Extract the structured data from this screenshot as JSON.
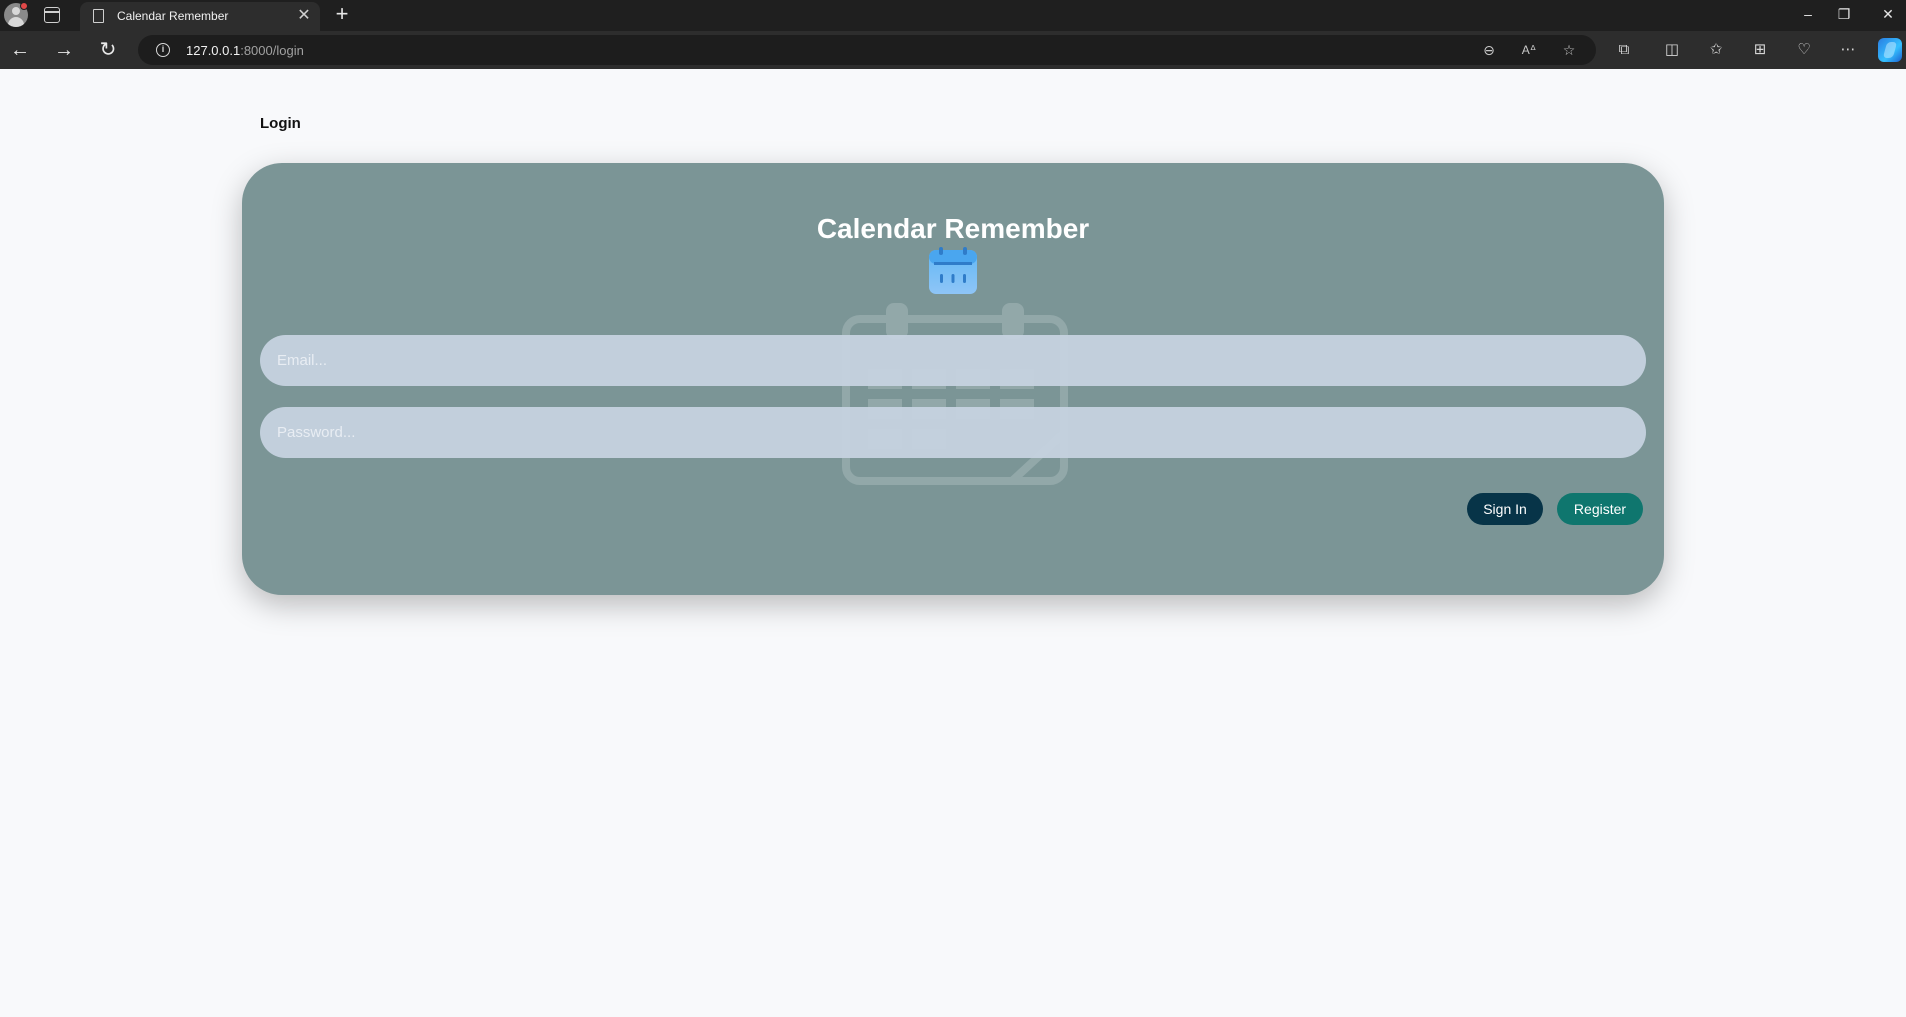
{
  "browser": {
    "tab_title": "Calendar Remember",
    "url_host": "127.0.0.1",
    "url_path": ":8000/login"
  },
  "page": {
    "nav_label": "Login"
  },
  "card": {
    "title": "Calendar Remember",
    "email_placeholder": "Email...",
    "password_placeholder": "Password...",
    "signin_label": "Sign In",
    "register_label": "Register"
  },
  "colors": {
    "card_bg": "#7b9596",
    "signin_bg": "#073448",
    "register_bg": "#0f766e",
    "page_bg": "#f8f9fb"
  }
}
